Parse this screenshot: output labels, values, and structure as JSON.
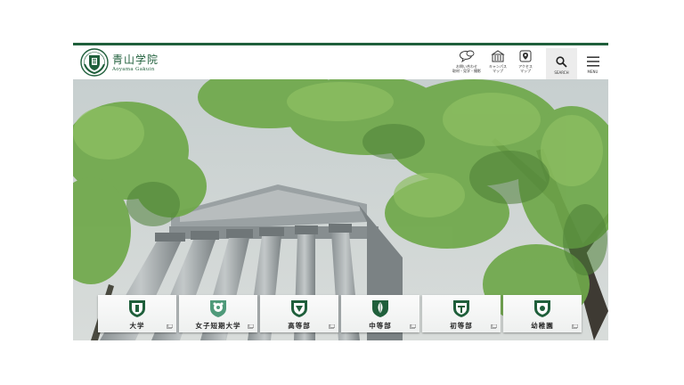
{
  "brand": {
    "name_jp": "青山学院",
    "name_en": "Aoyama Gakuin"
  },
  "nav": [
    {
      "icon": "chat-bubbles-icon",
      "label": "お問い合わせ\n取材・見学・撮影"
    },
    {
      "icon": "campus-building-icon",
      "label": "キャンパス\nマップ"
    },
    {
      "icon": "access-map-icon",
      "label": "アクセス\nマップ"
    }
  ],
  "search": {
    "icon": "search-icon",
    "label": "SEARCH"
  },
  "menu": {
    "icon": "hamburger-menu-icon",
    "label": "MENU"
  },
  "schools": [
    {
      "name": "大学",
      "crest": "shield-crest-icon"
    },
    {
      "name": "女子短期大学",
      "crest": "floral-crest-icon"
    },
    {
      "name": "高等部",
      "crest": "shield-crest-icon"
    },
    {
      "name": "中等部",
      "crest": "leaf-crest-icon"
    },
    {
      "name": "初等部",
      "crest": "shield-crest-icon"
    },
    {
      "name": "幼稚園",
      "crest": "shield-crest-icon"
    }
  ],
  "colors": {
    "brand_green": "#1f5f3b",
    "leaf_green": "#6fa84a",
    "sky": "#c9d1d1"
  }
}
